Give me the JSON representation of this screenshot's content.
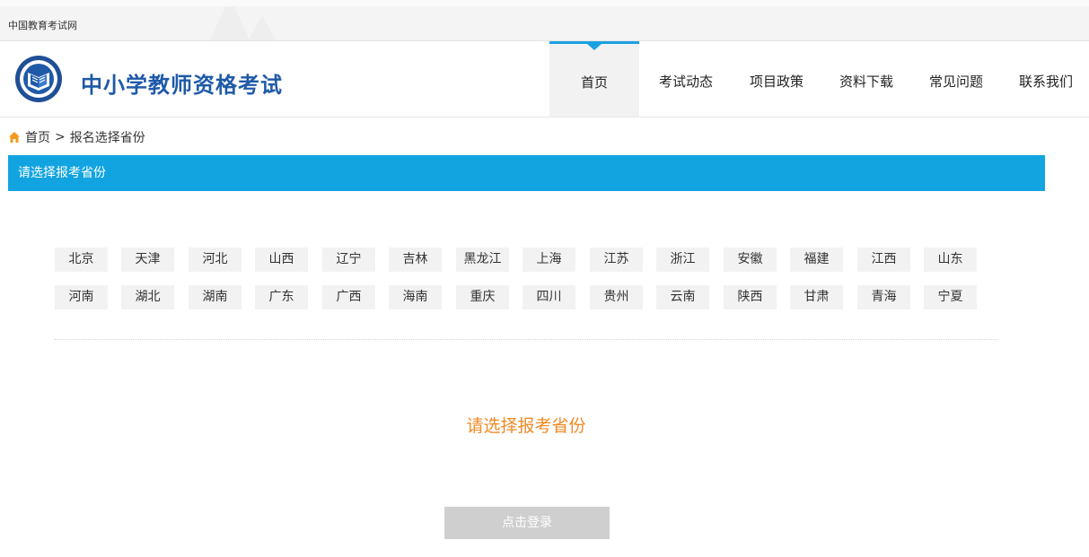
{
  "topbar": {
    "text": "中国教育考试网"
  },
  "header": {
    "site_title": "中小学教师资格考试",
    "nav": [
      {
        "label": "首页",
        "active": true
      },
      {
        "label": "考试动态"
      },
      {
        "label": "项目政策"
      },
      {
        "label": "资料下载"
      },
      {
        "label": "常见问题"
      },
      {
        "label": "联系我们"
      }
    ]
  },
  "breadcrumb": {
    "home": "首页",
    "separator": ">",
    "current": "报名选择省份"
  },
  "section": {
    "title": "请选择报考省份"
  },
  "provinces": {
    "row1": [
      "北京",
      "天津",
      "河北",
      "山西",
      "辽宁",
      "吉林",
      "黑龙江",
      "上海",
      "江苏",
      "浙江",
      "安徽",
      "福建",
      "江西",
      "山东"
    ],
    "row2": [
      "河南",
      "湖北",
      "湖南",
      "广东",
      "广西",
      "海南",
      "重庆",
      "四川",
      "贵州",
      "云南",
      "陕西",
      "甘肃",
      "青海",
      "宁夏"
    ]
  },
  "prompt": "请选择报考省份",
  "login_button": "点击登录",
  "colors": {
    "accent": "#12a4e0",
    "title": "#1f5aa8",
    "prompt": "#f08a24",
    "button_disabled": "#cfcfcf"
  }
}
